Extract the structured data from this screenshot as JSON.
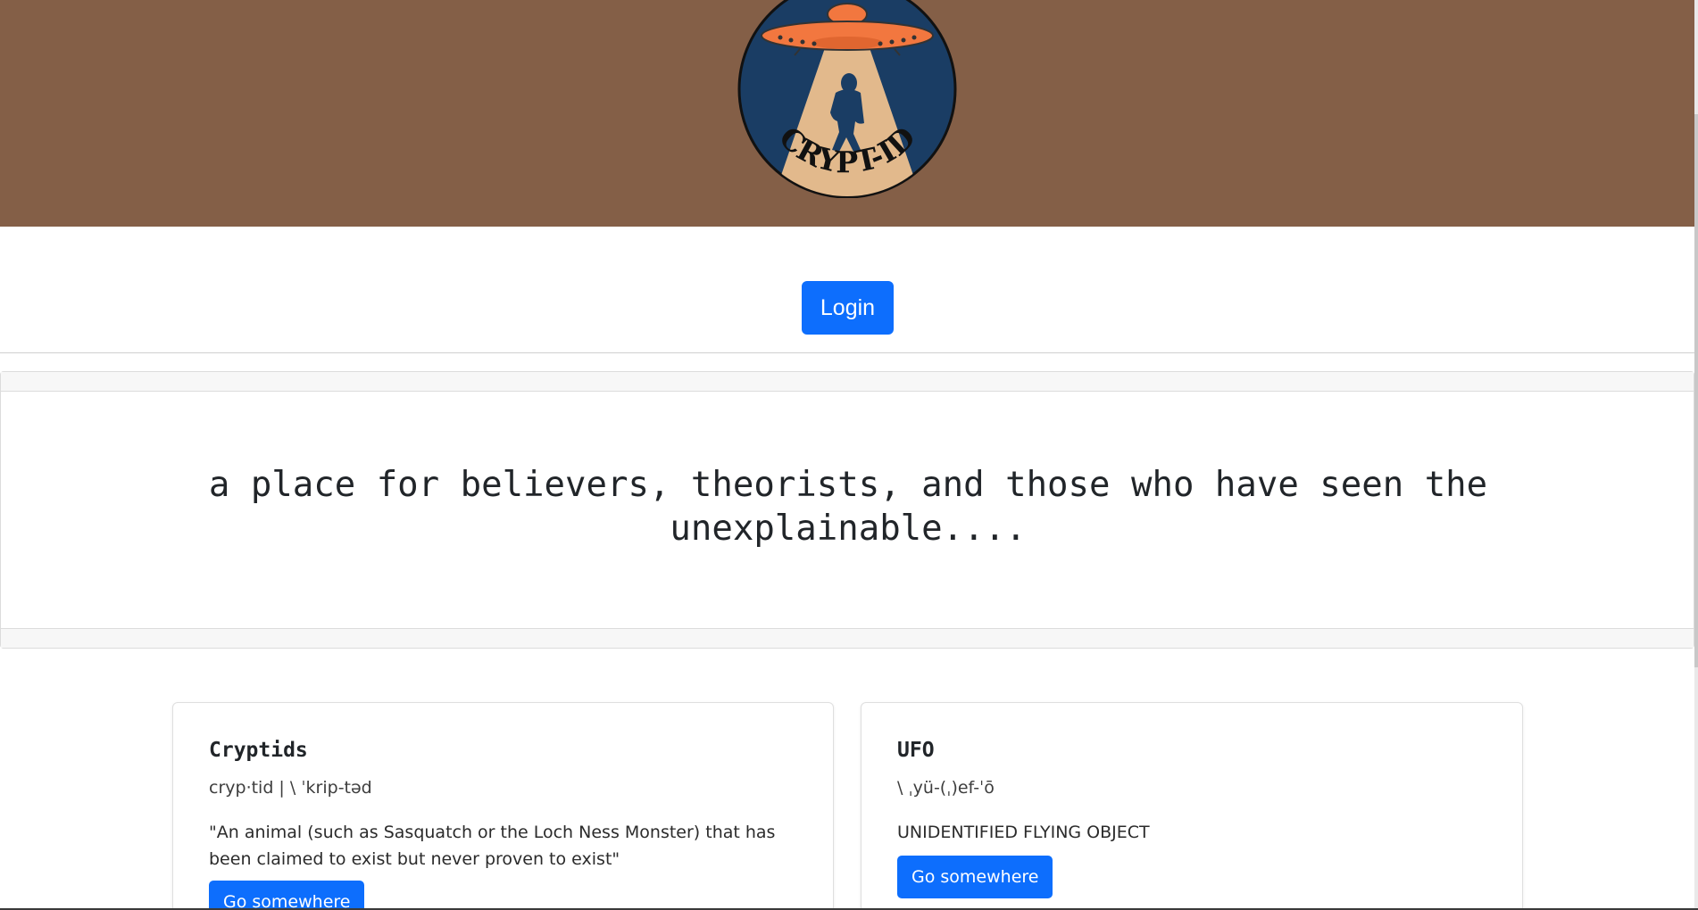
{
  "brand": {
    "logo_text": "CRYPT-ID",
    "header_color": "#845f47",
    "accent": "#0d6efd",
    "logo_sky": "#1a3d64",
    "logo_beam": "#e2b98c",
    "logo_ufo": "#f2773f"
  },
  "nav": {
    "login_label": "Login"
  },
  "hero": {
    "tagline": "a place for believers, theorists, and those who have seen the unexplainable...."
  },
  "cards": [
    {
      "title": "Cryptids",
      "pronunciation": "cryp·tid | \\ ˈkrip-təd",
      "text": "\"An animal (such as Sasquatch or the Loch Ness Monster) that has been claimed to exist but never proven to exist\"",
      "button_label": "Go somewhere"
    },
    {
      "title": "UFO",
      "pronunciation": "\\ ˌyü-(ˌ)ef-ˈō",
      "text": "UNIDENTIFIED FLYING OBJECT",
      "button_label": "Go somewhere"
    }
  ]
}
